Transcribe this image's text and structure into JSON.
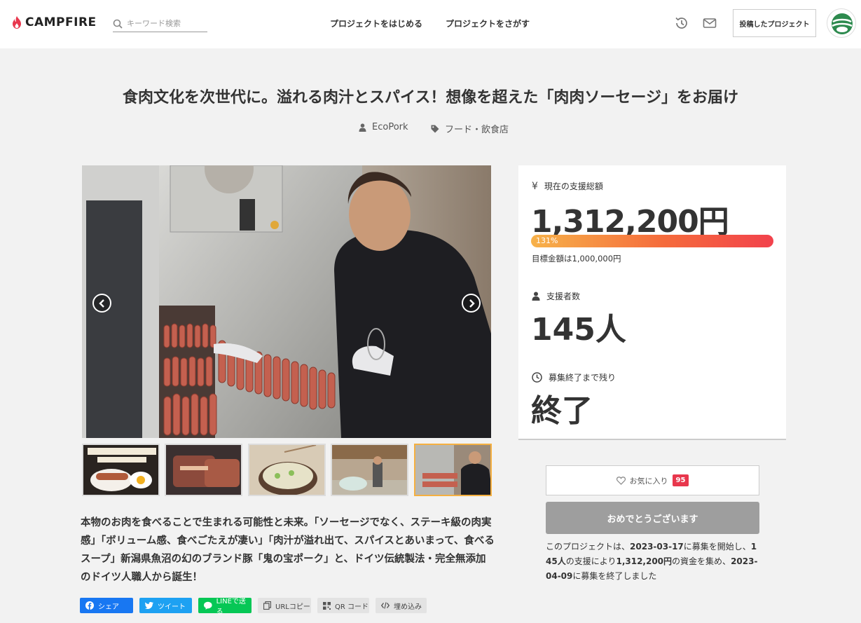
{
  "header": {
    "logo_text": "CAMPFIRE",
    "search_placeholder": "キーワード検索",
    "nav_start": "プロジェクトをはじめる",
    "nav_find": "プロジェクトをさがす",
    "posted_projects": "投稿したプロジェクト",
    "icons": [
      "history-icon",
      "mail-icon"
    ]
  },
  "project": {
    "title": "食肉文化を次世代に。溢れる肉汁とスパイス！想像を超えた「肉肉ソーセージ」をお届け",
    "owner": "EcoPork",
    "category": "フード・飲食店",
    "description": "本物のお肉を食べることで生まれる可能性と未来。「ソーセージでなく、ステーキ級の肉実感」「ボリューム感、食べごたえが凄い」「肉汁が溢れ出て、スパイスとあいまって、食べるスープ」新潟県魚沼の幻のブランド豚「鬼の宝ポーク」と、ドイツ伝統製法・完全無添加のドイツ人職人から誕生！",
    "thumbnail_count": 5,
    "active_thumbnail": 5
  },
  "share": {
    "facebook": "シェア",
    "twitter": "ツイート",
    "line": "LINEで送る",
    "url_copy": "URLコピー",
    "qr": "QR コード",
    "embed": "埋め込み"
  },
  "stats": {
    "amount_label": "現在の支援総額",
    "amount": "1,312,200円",
    "progress_text": "131%",
    "progress_fraction": 1.31,
    "goal": "目標金額は1,000,000円",
    "backers_label": "支援者数",
    "backers": "145人",
    "remaining_label": "募集終了まで残り",
    "remaining": "終了"
  },
  "actions": {
    "favorite_label": "お気に入り",
    "favorite_count": "95",
    "congrats": "おめでとうございます"
  },
  "summary": {
    "part1": "このプロジェクトは、",
    "start_date": "2023-03-17",
    "part2": "に募集を開始し、",
    "backers": "145人",
    "part3": "の支援により",
    "amount": "1,312,200円",
    "part4": "の資金を集め、",
    "end_date": "2023-04-09",
    "part5": "に募集を終了しました"
  },
  "colors": {
    "brand_red": "#e8374d",
    "progress_start": "#f7b24a",
    "progress_end": "#f2424c",
    "facebook": "#1877f2",
    "twitter": "#1da1f2",
    "line": "#06c755",
    "congrats_bg": "#9e9e9e"
  }
}
